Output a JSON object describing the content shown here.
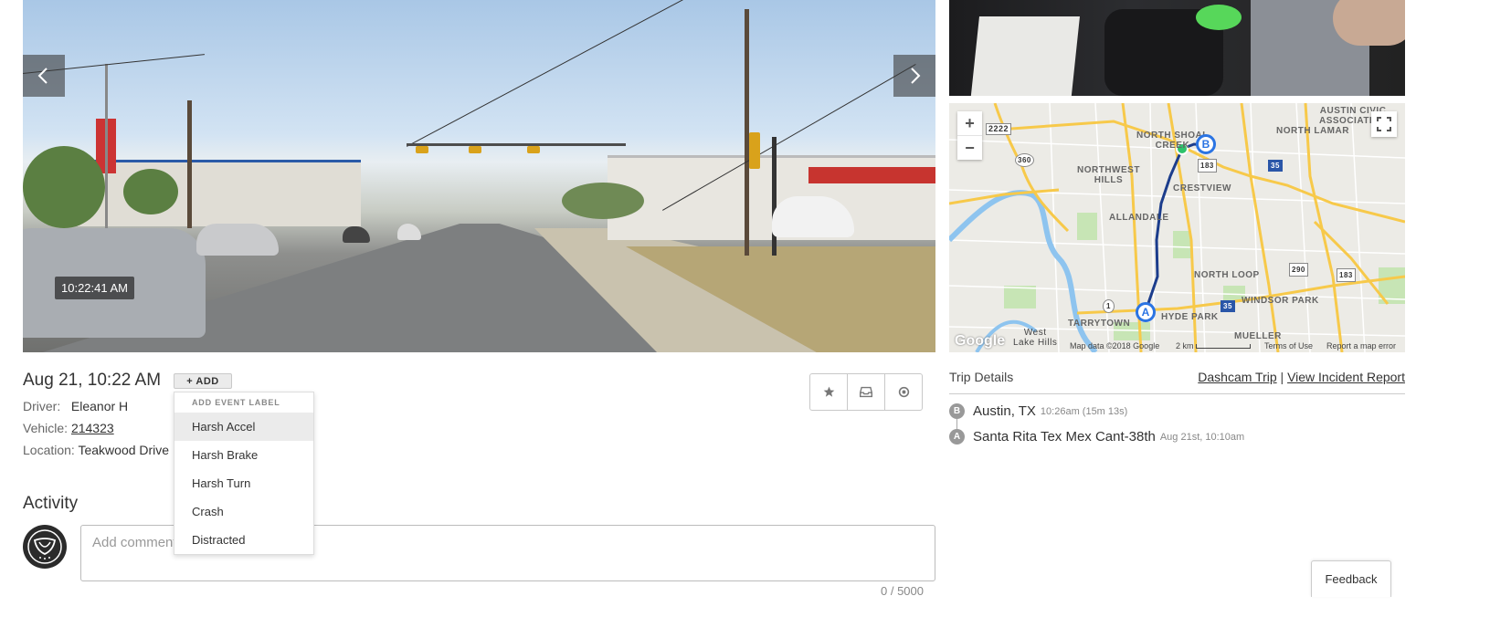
{
  "video": {
    "timestamp": "10:22:41 AM",
    "prev_icon": "chevron-left-icon",
    "next_icon": "chevron-right-icon"
  },
  "map": {
    "zoom_in": "+",
    "zoom_out": "−",
    "fullscreen_icon": "fullscreen-icon",
    "marker_a": "A",
    "marker_b": "B",
    "google": "Google",
    "attribution": "Map data ©2018 Google",
    "scale": "2 km",
    "terms": "Terms of Use",
    "report": "Report a map error",
    "labels": {
      "austin_civic": "AUSTIN CIVIC\nASSOCIATION",
      "north_shoal": "NORTH SHOAL\nCREEK",
      "north_lamar": "NORTH LAMAR",
      "northwest_hills": "NORTHWEST\nHILLS",
      "crestview": "CRESTVIEW",
      "allandale": "ALLANDALE",
      "north_loop": "NORTH LOOP",
      "windsor_park": "WINDSOR PARK",
      "tarrytown": "TARRYTOWN",
      "hyde_park": "HYDE PARK",
      "west_lake": "West\nLake Hills",
      "mueller": "MUELLER"
    },
    "shields": {
      "s2222": "2222",
      "s360": "360",
      "s183a": "183",
      "s35a": "35",
      "s290": "290",
      "s183b": "183",
      "s35b": "35",
      "s1": "1"
    }
  },
  "event": {
    "date": "Aug 21, 10:22 AM",
    "add_button": "+ ADD",
    "driver_label": "Driver:",
    "driver_value": "Eleanor H",
    "vehicle_label": "Vehicle:",
    "vehicle_value": "214323",
    "location_label": "Location:",
    "location_value": "Teakwood Drive"
  },
  "actions": {
    "star_icon": "star-icon",
    "inbox_icon": "inbox-icon",
    "circle_icon": "circle-icon"
  },
  "dropdown": {
    "header": "ADD EVENT LABEL",
    "items": [
      "Harsh Accel",
      "Harsh Brake",
      "Harsh Turn",
      "Crash",
      "Distracted"
    ],
    "active_item": "Harsh Accel"
  },
  "activity": {
    "title": "Activity",
    "comment_placeholder": "Add comment...",
    "char_count": "0 / 5000"
  },
  "trip": {
    "title": "Trip Details",
    "dashcam_link": "Dashcam Trip",
    "separator": "|",
    "incident_link": "View Incident Report",
    "stops": [
      {
        "badge": "B",
        "name": "Austin, TX",
        "meta": "10:26am (15m 13s)"
      },
      {
        "badge": "A",
        "name": "Santa Rita Tex Mex Cant-38th",
        "meta": "Aug 21st, 10:10am"
      }
    ]
  },
  "feedback": "Feedback",
  "colors": {
    "marker_blue": "#2b74e3",
    "route_navy": "#1c3d8c",
    "current_dot": "#2dc26b",
    "highway_yellow": "#f7c94a",
    "water_blue": "#8ec4ef"
  }
}
